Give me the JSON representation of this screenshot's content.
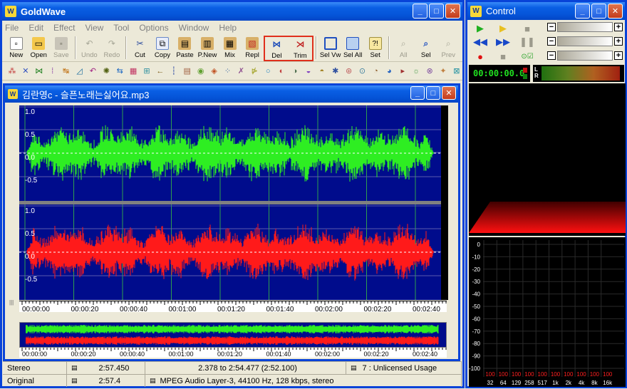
{
  "main_window": {
    "title": "GoldWave",
    "menu": [
      "File",
      "Edit",
      "Effect",
      "View",
      "Tool",
      "Options",
      "Window",
      "Help"
    ],
    "toolbar": [
      {
        "label": "New",
        "icon": "new-icon",
        "enabled": true
      },
      {
        "label": "Open",
        "icon": "open-icon",
        "enabled": true
      },
      {
        "label": "Save",
        "icon": "save-icon",
        "enabled": false
      },
      {
        "label": "Undo",
        "icon": "undo-icon",
        "enabled": false
      },
      {
        "label": "Redo",
        "icon": "redo-icon",
        "enabled": false
      },
      {
        "label": "Cut",
        "icon": "cut-icon",
        "enabled": true
      },
      {
        "label": "Copy",
        "icon": "copy-icon",
        "enabled": true
      },
      {
        "label": "Paste",
        "icon": "paste-icon",
        "enabled": true
      },
      {
        "label": "P.New",
        "icon": "paste-new-icon",
        "enabled": true
      },
      {
        "label": "Mix",
        "icon": "mix-icon",
        "enabled": true
      },
      {
        "label": "Repl",
        "icon": "replace-icon",
        "enabled": true
      },
      {
        "label": "Del",
        "icon": "delete-icon",
        "enabled": true,
        "highlighted": true
      },
      {
        "label": "Trim",
        "icon": "trim-icon",
        "enabled": true,
        "highlighted": true
      },
      {
        "label": "Sel Vw",
        "icon": "select-view-icon",
        "enabled": true
      },
      {
        "label": "Sel All",
        "icon": "select-all-icon",
        "enabled": true
      },
      {
        "label": "Set",
        "icon": "set-icon",
        "enabled": true
      },
      {
        "label": "All",
        "icon": "zoom-all-icon",
        "enabled": false
      },
      {
        "label": "Sel",
        "icon": "zoom-select-icon",
        "enabled": true
      },
      {
        "label": "Prev",
        "icon": "zoom-prev-icon",
        "enabled": false
      }
    ]
  },
  "document": {
    "title": "김란영c - 슬픈노래는싫어요.mp3",
    "amp_labels": [
      "1.0",
      "0.5",
      "0.0",
      "-0.5"
    ],
    "time_labels": [
      "00:00:00",
      "00:00:20",
      "00:00:40",
      "00:01:00",
      "00:01:20",
      "00:01:40",
      "00:02:00",
      "00:02:20",
      "00:02:40"
    ],
    "left_color": "#2EEE22",
    "right_color": "#FF1A1A"
  },
  "status": {
    "row1": [
      "Stereo",
      "2:57.450",
      "2.378 to 2:54.477 (2:52.100)",
      "7 : Unlicensed Usage"
    ],
    "row2": [
      "Original",
      "2:57.4",
      "MPEG Audio Layer-3, 44100 Hz, 128 kbps, stereo"
    ]
  },
  "control": {
    "title": "Control",
    "time": "00:00:00.0",
    "db_labels": [
      "0",
      "-10",
      "-20",
      "-30",
      "-40",
      "-50",
      "-60",
      "-70",
      "-80",
      "-90",
      "-100"
    ],
    "freq_labels": [
      "32",
      "64",
      "129",
      "258",
      "517",
      "1k",
      "2k",
      "4k",
      "8k",
      "16k"
    ],
    "peak_label": "100"
  }
}
